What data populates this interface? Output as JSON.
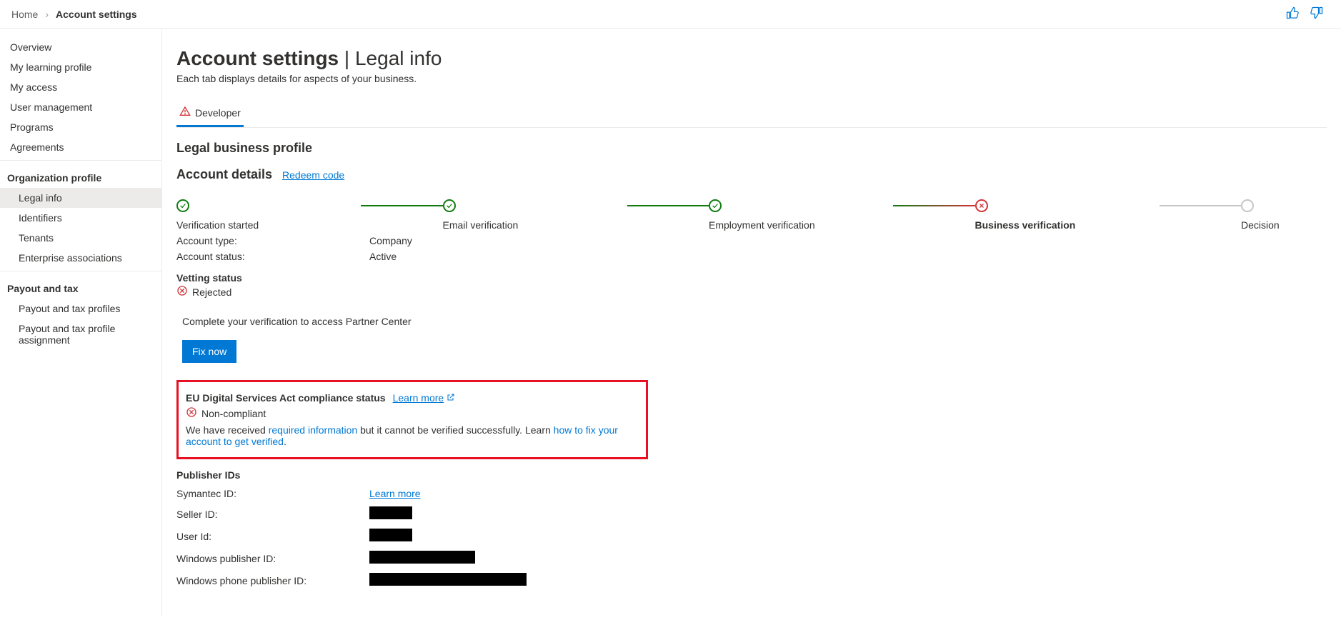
{
  "breadcrumb": {
    "home": "Home",
    "current": "Account settings"
  },
  "sidebar": {
    "items": [
      "Overview",
      "My learning profile",
      "My access",
      "User management",
      "Programs",
      "Agreements"
    ],
    "group_org": "Organization profile",
    "org_items": [
      "Legal info",
      "Identifiers",
      "Tenants",
      "Enterprise associations"
    ],
    "group_payout": "Payout and tax",
    "payout_items": [
      "Payout and tax profiles",
      "Payout and tax profile assignment"
    ]
  },
  "page": {
    "title_main": "Account settings",
    "title_sub": "Legal info",
    "subtitle": "Each tab displays details for aspects of your business."
  },
  "tab": {
    "developer": "Developer"
  },
  "legal": {
    "profile_title": "Legal business profile",
    "account_details": "Account details",
    "redeem": "Redeem code"
  },
  "steps": [
    {
      "label": "Verification started"
    },
    {
      "label": "Email verification"
    },
    {
      "label": "Employment verification"
    },
    {
      "label": "Business verification"
    },
    {
      "label": "Decision"
    }
  ],
  "details": {
    "account_type_k": "Account type:",
    "account_type_v": "Company",
    "account_status_k": "Account status:",
    "account_status_v": "Active"
  },
  "vetting": {
    "head": "Vetting status",
    "value": "Rejected"
  },
  "fix": {
    "msg": "Complete your verification to access Partner Center",
    "btn": "Fix now"
  },
  "compliance": {
    "title": "EU Digital Services Act compliance status",
    "learn_more": "Learn more",
    "status": "Non-compliant",
    "msg_pre": "We have received ",
    "msg_link1": "required information",
    "msg_mid": " but it cannot be verified successfully. Learn ",
    "msg_link2": "how to fix your account to get verified",
    "msg_post": "."
  },
  "publisher": {
    "title": "Publisher IDs",
    "symantec_k": "Symantec ID:",
    "symantec_link": "Learn more",
    "seller_k": "Seller ID:",
    "user_k": "User Id:",
    "win_pub_k": "Windows publisher ID:",
    "winphone_pub_k": "Windows phone publisher ID:"
  }
}
